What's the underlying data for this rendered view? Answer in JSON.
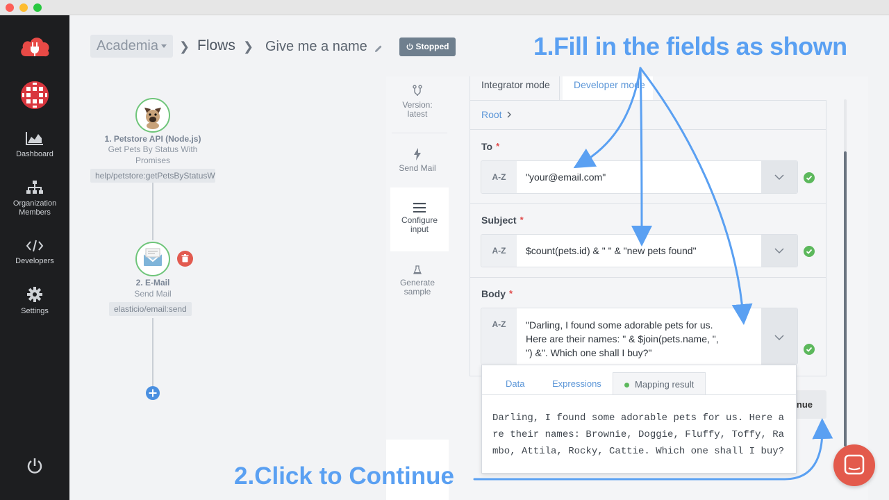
{
  "sidebar": {
    "items": [
      {
        "label": "Dashboard",
        "icon": "chart-area-icon"
      },
      {
        "label": "Organization Members",
        "icon": "org-chart-icon"
      },
      {
        "label": "Developers",
        "icon": "code-icon"
      },
      {
        "label": "Settings",
        "icon": "gear-icon"
      }
    ]
  },
  "header": {
    "org": "Academia",
    "flows": "Flows",
    "flow_name": "Give me a name",
    "status": "Stopped"
  },
  "flow": {
    "nodes": [
      {
        "title": "1. Petstore API (Node.js)",
        "subtitle": "Get Pets By Status With Promises",
        "tag": "help/petstore:getPetsByStatusW"
      },
      {
        "title": "2. E-Mail",
        "subtitle": "Send Mail",
        "tag": "elasticio/email:send"
      }
    ]
  },
  "steps": [
    {
      "label": "Version: latest"
    },
    {
      "label": "Send Mail"
    },
    {
      "label": "Configure input"
    },
    {
      "label": "Generate sample"
    }
  ],
  "tabs": {
    "integrator": "Integrator mode",
    "developer": "Developer mode"
  },
  "root": "Root",
  "fields": {
    "to": {
      "label": "To",
      "type": "A-Z",
      "value": "\"your@email.com\""
    },
    "subject": {
      "label": "Subject",
      "type": "A-Z",
      "value": "$count(pets.id) & \" \" & \"new pets found\""
    },
    "body": {
      "label": "Body",
      "type": "A-Z",
      "value": "\"Darling, I found some adorable pets for us. Here are their names: \" & $join(pets.name, \", \") &\". Which one shall I buy?\""
    }
  },
  "required_mark": "*",
  "popup": {
    "tabs": [
      "Data",
      "Expressions",
      "Mapping result"
    ],
    "result": "Darling, I found some adorable pets for us. Here are their names: Brownie, Doggie, Fluffy, Toffy, Rambo, Attila, Rocky, Cattie. Which one shall I buy?"
  },
  "continue_label": "Continue",
  "annotations": {
    "step1": "1.Fill in the fields as shown",
    "step2": "2.Click to Continue"
  },
  "colors": {
    "accent": "#5aa0f2",
    "success": "#5cb85c",
    "danger": "#e25a4f"
  }
}
